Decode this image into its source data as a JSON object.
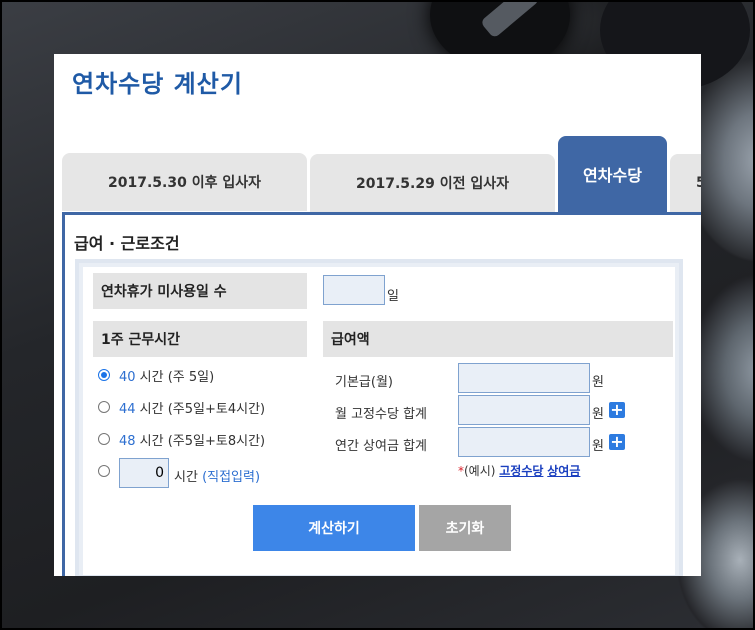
{
  "page": {
    "title": "연차수당 계산기"
  },
  "tabs": [
    {
      "label": "2017.5.30 이후 입사자"
    },
    {
      "label": "2017.5.29 이전 입사자"
    },
    {
      "label": "연차수당"
    },
    {
      "label": "5"
    }
  ],
  "form": {
    "section_title": "급여 · 근로조건",
    "unused_days": {
      "label": "연차휴가 미사용일 수",
      "value": "",
      "unit": "일"
    },
    "weekly_hours": {
      "header": "1주 근무시간",
      "options": [
        {
          "num": "40",
          "text": " 시간 (주 5일)",
          "selected": true
        },
        {
          "num": "44",
          "text": " 시간 (주5일+토4시간)",
          "selected": false
        },
        {
          "num": "48",
          "text": " 시간 (주5일+토8시간)",
          "selected": false
        }
      ],
      "custom": {
        "value": "0",
        "unit": "시간",
        "hint": "(직접입력)"
      }
    },
    "salary": {
      "header": "급여액",
      "fields": [
        {
          "label": "기본급(월)",
          "unit": "원"
        },
        {
          "label": "월 고정수당 합계",
          "unit": "원"
        },
        {
          "label": "연간 상여금 합계",
          "unit": "원"
        }
      ],
      "note": {
        "asterisk": "*",
        "prefix": "(예시) ",
        "link1": "고정수당",
        "link2": "상여금"
      }
    }
  },
  "buttons": {
    "calculate": "계산하기",
    "reset": "초기화"
  },
  "colors": {
    "accent": "#3f67a5",
    "title": "#1f5aa6",
    "button": "#3d86e8"
  }
}
